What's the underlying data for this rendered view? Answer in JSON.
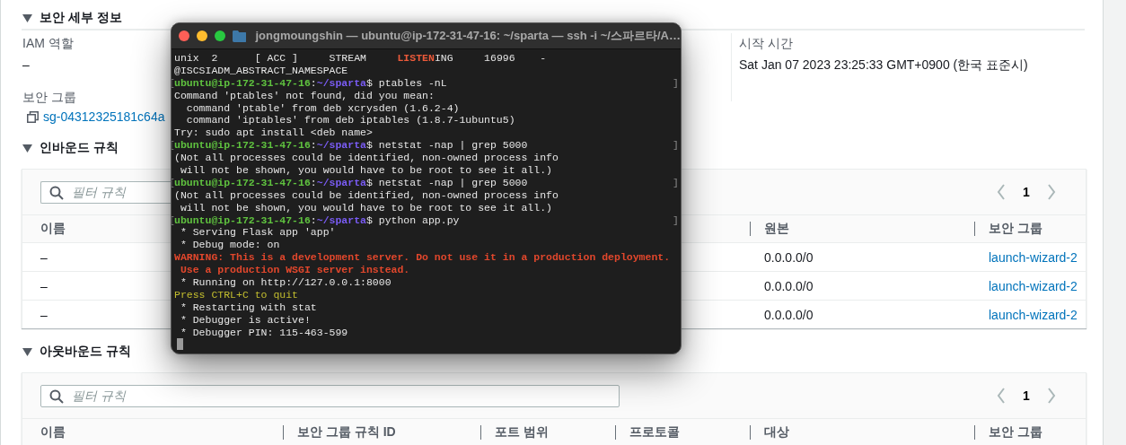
{
  "details_section": {
    "title": "보안 세부 정보",
    "expanded": true,
    "columns": [
      {
        "fields": [
          {
            "label": "IAM 역할",
            "value": "–"
          },
          {
            "label": "보안 그룹",
            "link": "sg-04312325181c64a"
          }
        ]
      },
      {
        "fields": [
          {
            "label": "시작 시간",
            "value": "Sat Jan 07 2023 23:25:33 GMT+0900 (한국 표준시)"
          }
        ]
      }
    ]
  },
  "inbound_rules": {
    "title": "인바운드 규칙",
    "expanded": true,
    "filter": {
      "placeholder": "필터 규칙"
    },
    "page": "1",
    "columns": [
      {
        "label": "이름"
      },
      {
        "label": "원본"
      },
      {
        "label": "보안 그룹"
      }
    ],
    "rows": [
      {
        "name": "–",
        "source": "0.0.0.0/0",
        "security_group": "launch-wizard-2"
      },
      {
        "name": "–",
        "source": "0.0.0.0/0",
        "security_group": "launch-wizard-2"
      },
      {
        "name": "–",
        "source": "0.0.0.0/0",
        "security_group": "launch-wizard-2"
      }
    ]
  },
  "outbound_rules": {
    "title": "아웃바운드 규칙",
    "expanded": true,
    "filter": {
      "placeholder": "필터 규칙"
    },
    "page": "1",
    "columns": [
      {
        "label": "이름"
      },
      {
        "label": "보안 그룹 규칙 ID"
      },
      {
        "label": "포트 범위"
      },
      {
        "label": "프로토콜"
      },
      {
        "label": "대상"
      },
      {
        "label": "보안 그룹"
      }
    ]
  },
  "terminal": {
    "title": "jongmoungshin — ubuntu@ip-172-31-47-16: ~/sparta — ssh -i ~/스파르타/A…",
    "lines": [
      {
        "segments": [
          {
            "kind": "plain",
            "text": "unix  2      [ ACC ]     STREAM     "
          },
          {
            "kind": "highlight",
            "text": "LISTEN"
          },
          {
            "kind": "plain",
            "text": "ING     16996    -"
          }
        ]
      },
      {
        "segments": [
          {
            "kind": "plain",
            "text": "@ISCSIADM_ABSTRACT_NAMESPACE"
          }
        ]
      },
      {
        "mark_open": "[",
        "mark_close": "]",
        "segments": [
          {
            "kind": "user",
            "text": "ubuntu@ip-172-31-47-16"
          },
          {
            "kind": "plain",
            "text": ":"
          },
          {
            "kind": "path",
            "text": "~/sparta"
          },
          {
            "kind": "plain",
            "text": "$ ptables -nL"
          }
        ]
      },
      {
        "segments": [
          {
            "kind": "plain",
            "text": "Command 'ptables' not found, did you mean:"
          }
        ]
      },
      {
        "segments": [
          {
            "kind": "plain",
            "text": "  command 'ptable' from deb xcrysden (1.6.2-4)"
          }
        ]
      },
      {
        "segments": [
          {
            "kind": "plain",
            "text": "  command 'iptables' from deb iptables (1.8.7-1ubuntu5)"
          }
        ]
      },
      {
        "segments": [
          {
            "kind": "plain",
            "text": "Try: sudo apt install <deb name>"
          }
        ]
      },
      {
        "mark_open": "[",
        "mark_close": "]",
        "segments": [
          {
            "kind": "user",
            "text": "ubuntu@ip-172-31-47-16"
          },
          {
            "kind": "plain",
            "text": ":"
          },
          {
            "kind": "path",
            "text": "~/sparta"
          },
          {
            "kind": "plain",
            "text": "$ netstat -nap | grep 5000"
          }
        ]
      },
      {
        "segments": [
          {
            "kind": "plain",
            "text": "(Not all processes could be identified, non-owned process info"
          }
        ]
      },
      {
        "segments": [
          {
            "kind": "plain",
            "text": " will not be shown, you would have to be root to see it all.)"
          }
        ]
      },
      {
        "mark_open": "[",
        "mark_close": "]",
        "segments": [
          {
            "kind": "user",
            "text": "ubuntu@ip-172-31-47-16"
          },
          {
            "kind": "plain",
            "text": ":"
          },
          {
            "kind": "path",
            "text": "~/sparta"
          },
          {
            "kind": "plain",
            "text": "$ netstat -nap | grep 5000"
          }
        ]
      },
      {
        "segments": [
          {
            "kind": "plain",
            "text": "(Not all processes could be identified, non-owned process info"
          }
        ]
      },
      {
        "segments": [
          {
            "kind": "plain",
            "text": " will not be shown, you would have to be root to see it all.)"
          }
        ]
      },
      {
        "mark_open": "[",
        "mark_close": "]",
        "segments": [
          {
            "kind": "user",
            "text": "ubuntu@ip-172-31-47-16"
          },
          {
            "kind": "plain",
            "text": ":"
          },
          {
            "kind": "path",
            "text": "~/sparta"
          },
          {
            "kind": "plain",
            "text": "$ python app.py"
          }
        ]
      },
      {
        "segments": [
          {
            "kind": "plain",
            "text": " * Serving Flask app 'app'"
          }
        ]
      },
      {
        "segments": [
          {
            "kind": "plain",
            "text": " * Debug mode: on"
          }
        ]
      },
      {
        "segments": [
          {
            "kind": "error",
            "text": "WARNING: This is a development server. Do not use it in a production deployment."
          }
        ]
      },
      {
        "segments": [
          {
            "kind": "error",
            "text": " Use a production WSGI server instead."
          }
        ]
      },
      {
        "segments": [
          {
            "kind": "plain",
            "text": " * Running on http://127.0.0.1:8000"
          }
        ]
      },
      {
        "segments": [
          {
            "kind": "warn",
            "text": "Press CTRL+C to quit"
          }
        ]
      },
      {
        "segments": [
          {
            "kind": "plain",
            "text": " * Restarting with stat"
          }
        ]
      },
      {
        "segments": [
          {
            "kind": "plain",
            "text": " * Debugger is active!"
          }
        ]
      },
      {
        "segments": [
          {
            "kind": "plain",
            "text": " * Debugger PIN: 115-463-599"
          }
        ]
      }
    ],
    "cursor": true
  }
}
